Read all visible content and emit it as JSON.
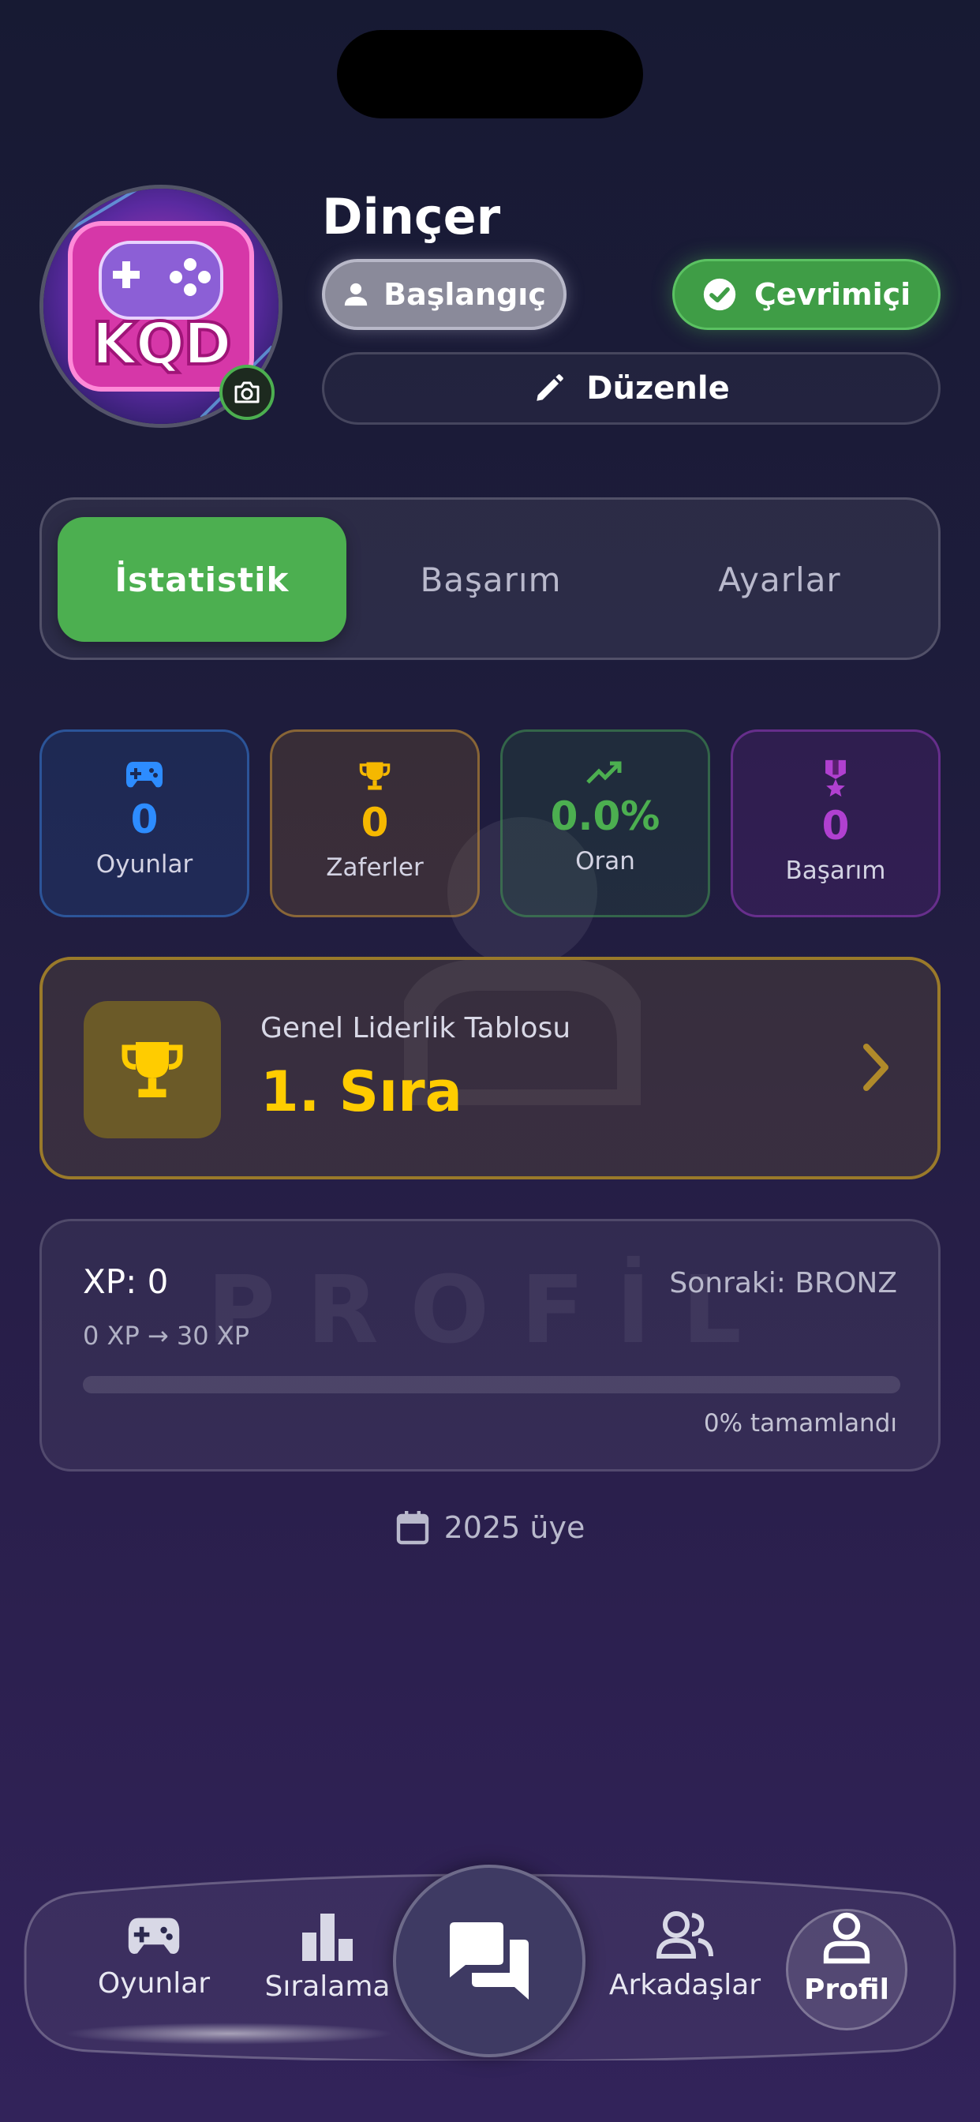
{
  "profile": {
    "username": "Dinçer",
    "avatar_text": "KQD",
    "rank_label": "Başlangıç",
    "status_label": "Çevrimiçi",
    "edit_label": "Düzenle"
  },
  "tabs": [
    {
      "label": "İstatistik",
      "active": true
    },
    {
      "label": "Başarım",
      "active": false
    },
    {
      "label": "Ayarlar",
      "active": false
    }
  ],
  "stats": [
    {
      "icon": "gamepad-icon",
      "value": "0",
      "label": "Oyunlar",
      "color": "#2d8cff"
    },
    {
      "icon": "trophy-icon",
      "value": "0",
      "label": "Zaferler",
      "color": "#f5b800"
    },
    {
      "icon": "trending-up-icon",
      "value": "0.0%",
      "label": "Oran",
      "color": "#4caf50"
    },
    {
      "icon": "medal-icon",
      "value": "0",
      "label": "Başarım",
      "color": "#b040d0"
    }
  ],
  "leaderboard": {
    "title": "Genel Liderlik Tablosu",
    "value": "1. Sıra"
  },
  "xp": {
    "label": "XP: 0",
    "next": "Sonraki: BRONZ",
    "range": "0 XP → 30 XP",
    "progress": 0,
    "percent_label": "0% tamamlandı"
  },
  "member_since": "2025 üye",
  "watermark": "PROFİL",
  "nav": {
    "items": [
      {
        "label": "Oyunlar",
        "icon": "gamepad-icon"
      },
      {
        "label": "Sıralama",
        "icon": "bar-chart-icon"
      },
      {
        "label": "Arkadaşlar",
        "icon": "friends-icon"
      },
      {
        "label": "Profil",
        "icon": "user-icon",
        "active": true
      }
    ],
    "center_icon": "chat-icon"
  },
  "colors": {
    "accent_green": "#4caf50",
    "gold": "#ffcc00"
  }
}
